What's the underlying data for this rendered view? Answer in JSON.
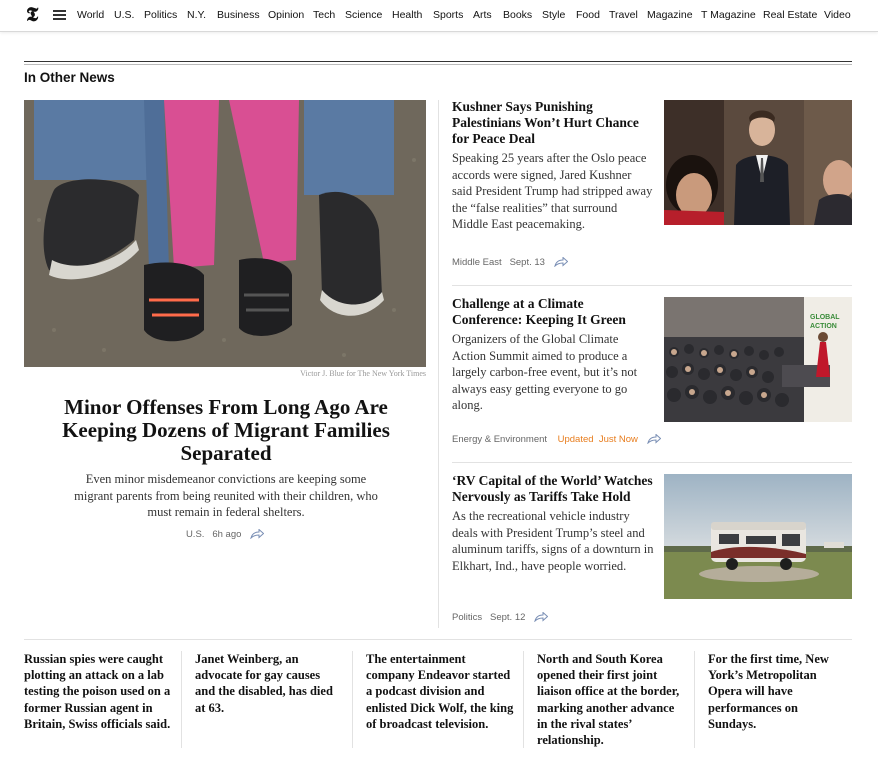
{
  "nav": {
    "logo": "𝕿",
    "items": [
      "World",
      "U.S.",
      "Politics",
      "N.Y.",
      "Business",
      "Opinion",
      "Tech",
      "Science",
      "Health",
      "Sports",
      "Arts",
      "Books",
      "Style",
      "Food",
      "Travel",
      "Magazine",
      "T Magazine",
      "Real Estate",
      "Video"
    ]
  },
  "section_title": "In Other News",
  "hero": {
    "credit": "Victor J. Blue for The New York Times",
    "headline": "Minor Offenses From Long Ago Are Keeping Dozens of Migrant Families Separated",
    "summary": "Even minor misdemeanor convictions are keeping some migrant parents from being reunited with their children, who must remain in federal shelters.",
    "section": "U.S.",
    "time": "6h ago"
  },
  "stories": [
    {
      "headline": "Kushner Says Punishing Palestinians Won’t Hurt Chance for Peace Deal",
      "summary": "Speaking 25 years after the Oslo peace accords were signed, Jared Kushner said President Trump had stripped away the “false realities” that surround Middle East peacemaking.",
      "section": "Middle East",
      "time": "Sept. 13",
      "updated": ""
    },
    {
      "headline": "Challenge at a Climate Conference: Keeping It Green",
      "summary": "Organizers of the Global Climate Action Summit aimed to produce a largely carbon-free event, but it’s not always easy getting everyone to go along.",
      "section": "Energy & Environment",
      "time": "Just Now",
      "updated": "Updated"
    },
    {
      "headline": "‘RV Capital of the World’ Watches Nervously as Tariffs Take Hold",
      "summary": "As the recreational vehicle industry deals with President Trump’s steel and aluminum tariffs, signs of a downturn in Elkhart, Ind., have people worried.",
      "section": "Politics",
      "time": "Sept. 12",
      "updated": ""
    }
  ],
  "briefs": [
    "Russian spies were caught plotting an attack on a lab testing the poison used on a former Russian agent in Britain, Swiss officials said.",
    "Janet Weinberg, an advocate for gay causes and the disabled, has died at 63.",
    "The entertainment company Endeavor started a podcast division and enlisted Dick Wolf, the king of broadcast television.",
    "North and South Korea opened their first joint liaison office at the border, marking another advance in the rival states’ relationship.",
    "For the first time, New York’s Metropolitan Opera will have performances on Sundays."
  ],
  "colors": {
    "updated": "#e87d1e",
    "meta": "#666666"
  }
}
